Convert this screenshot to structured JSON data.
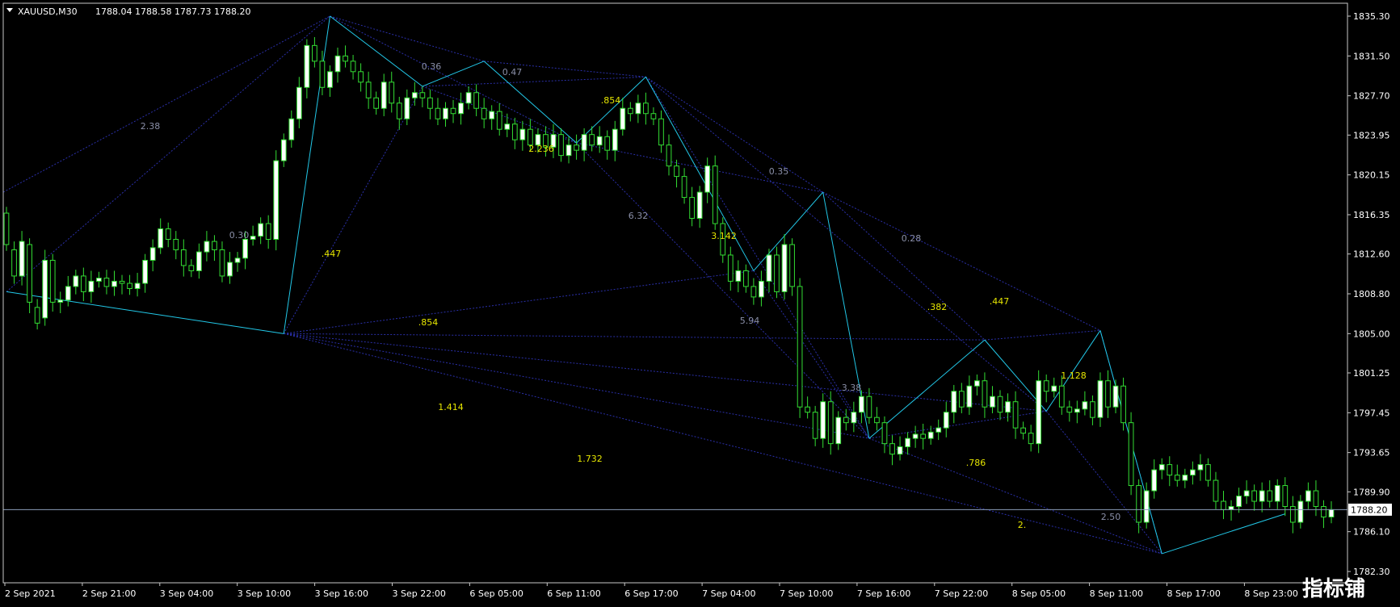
{
  "chart_data": {
    "type": "candlestick",
    "header": {
      "symbol": "XAUUSD,M30",
      "ohlc": "1788.04 1788.58 1787.73 1788.20"
    },
    "ylim": [
      1781.5,
      1836.5
    ],
    "y_ticks": [
      "1835.30",
      "1831.50",
      "1827.70",
      "1823.95",
      "1820.15",
      "1816.35",
      "1812.60",
      "1808.80",
      "1805.00",
      "1801.25",
      "1797.45",
      "1793.65",
      "1789.90",
      "1786.10",
      "1782.30"
    ],
    "x_ticks": [
      "2 Sep 2021",
      "2 Sep 21:00",
      "3 Sep 04:00",
      "3 Sep 10:00",
      "3 Sep 16:00",
      "3 Sep 22:00",
      "6 Sep 05:00",
      "6 Sep 11:00",
      "6 Sep 17:00",
      "7 Sep 04:00",
      "7 Sep 10:00",
      "7 Sep 16:00",
      "7 Sep 22:00",
      "8 Sep 05:00",
      "8 Sep 11:00",
      "8 Sep 17:00",
      "8 Sep 23:00"
    ],
    "current_price": "1788.20",
    "candles": [
      [
        1816.5,
        1813.5
      ],
      [
        1813.0,
        1810.5
      ],
      [
        1810.5,
        1813.8
      ],
      [
        1813.5,
        1808.0
      ],
      [
        1807.5,
        1806.0
      ],
      [
        1806.5,
        1812.0
      ],
      [
        1812.0,
        1808.0
      ],
      [
        1808.0,
        1808.2
      ],
      [
        1808.2,
        1809.5
      ],
      [
        1809.5,
        1810.5
      ],
      [
        1810.5,
        1809.0
      ],
      [
        1809.0,
        1810.0
      ],
      [
        1810.0,
        1810.3
      ],
      [
        1810.3,
        1809.5
      ],
      [
        1809.5,
        1810.0
      ],
      [
        1810.0,
        1809.8
      ],
      [
        1809.8,
        1809.3
      ],
      [
        1809.3,
        1809.8
      ],
      [
        1809.8,
        1812.0
      ],
      [
        1812.0,
        1813.2
      ],
      [
        1813.2,
        1815.0
      ],
      [
        1815.0,
        1814.0
      ],
      [
        1814.0,
        1813.0
      ],
      [
        1813.0,
        1811.5
      ],
      [
        1811.5,
        1811.0
      ],
      [
        1811.0,
        1812.8
      ],
      [
        1812.8,
        1813.8
      ],
      [
        1813.8,
        1813.0
      ],
      [
        1813.0,
        1810.5
      ],
      [
        1810.5,
        1811.8
      ],
      [
        1811.8,
        1812.2
      ],
      [
        1812.2,
        1814.0
      ],
      [
        1814.0,
        1814.3
      ],
      [
        1814.3,
        1815.5
      ],
      [
        1815.5,
        1814.0
      ],
      [
        1814.0,
        1821.5
      ],
      [
        1821.5,
        1823.5
      ],
      [
        1823.5,
        1825.5
      ],
      [
        1825.5,
        1828.5
      ],
      [
        1828.5,
        1832.5
      ],
      [
        1832.5,
        1831.0
      ],
      [
        1831.0,
        1828.5
      ],
      [
        1828.5,
        1830.0
      ],
      [
        1830.0,
        1831.5
      ],
      [
        1831.5,
        1831.0
      ],
      [
        1831.0,
        1830.0
      ],
      [
        1830.0,
        1829.0
      ],
      [
        1829.0,
        1827.5
      ],
      [
        1827.5,
        1826.5
      ],
      [
        1826.5,
        1829.0
      ],
      [
        1829.0,
        1827.0
      ],
      [
        1827.0,
        1825.5
      ],
      [
        1825.5,
        1827.5
      ],
      [
        1827.5,
        1828.0
      ],
      [
        1828.0,
        1827.5
      ],
      [
        1827.5,
        1826.5
      ],
      [
        1826.5,
        1825.5
      ],
      [
        1825.5,
        1826.5
      ],
      [
        1826.5,
        1826.0
      ],
      [
        1826.0,
        1827.0
      ],
      [
        1827.0,
        1828.0
      ],
      [
        1828.0,
        1826.5
      ],
      [
        1826.5,
        1825.5
      ],
      [
        1825.5,
        1826.2
      ],
      [
        1826.2,
        1824.5
      ],
      [
        1824.5,
        1825.0
      ],
      [
        1825.0,
        1823.5
      ],
      [
        1823.5,
        1824.5
      ],
      [
        1824.5,
        1823.0
      ],
      [
        1823.0,
        1824.0
      ],
      [
        1824.0,
        1822.8
      ],
      [
        1822.8,
        1824.0
      ],
      [
        1824.0,
        1822.0
      ],
      [
        1822.0,
        1823.0
      ],
      [
        1823.0,
        1822.5
      ],
      [
        1822.5,
        1824.0
      ],
      [
        1824.0,
        1823.0
      ],
      [
        1823.0,
        1823.8
      ],
      [
        1823.8,
        1822.5
      ],
      [
        1822.5,
        1824.5
      ],
      [
        1824.5,
        1826.5
      ],
      [
        1826.5,
        1826.0
      ],
      [
        1826.0,
        1827.0
      ],
      [
        1827.0,
        1826.0
      ],
      [
        1826.0,
        1825.5
      ],
      [
        1825.5,
        1823.0
      ],
      [
        1823.0,
        1821.0
      ],
      [
        1821.0,
        1820.0
      ],
      [
        1820.0,
        1818.0
      ],
      [
        1818.0,
        1816.0
      ],
      [
        1816.0,
        1818.5
      ],
      [
        1818.5,
        1821.0
      ],
      [
        1821.0,
        1815.5
      ],
      [
        1815.5,
        1812.5
      ],
      [
        1812.5,
        1810.0
      ],
      [
        1810.0,
        1811.0
      ],
      [
        1811.0,
        1809.5
      ],
      [
        1809.5,
        1808.5
      ],
      [
        1808.5,
        1810.0
      ],
      [
        1810.0,
        1812.5
      ],
      [
        1812.5,
        1809.0
      ],
      [
        1809.0,
        1813.5
      ],
      [
        1813.5,
        1809.5
      ],
      [
        1809.5,
        1798.0
      ],
      [
        1798.0,
        1797.5
      ],
      [
        1797.5,
        1795.0
      ],
      [
        1795.0,
        1798.5
      ],
      [
        1798.5,
        1794.5
      ],
      [
        1794.5,
        1797.0
      ],
      [
        1797.0,
        1796.5
      ],
      [
        1796.5,
        1797.5
      ],
      [
        1797.5,
        1799.0
      ],
      [
        1799.0,
        1797.0
      ],
      [
        1797.0,
        1796.5
      ],
      [
        1796.5,
        1794.5
      ],
      [
        1794.5,
        1793.5
      ],
      [
        1793.5,
        1794.2
      ],
      [
        1794.2,
        1795.0
      ],
      [
        1795.0,
        1795.4
      ],
      [
        1795.4,
        1795.0
      ],
      [
        1795.0,
        1795.6
      ],
      [
        1795.6,
        1796.0
      ],
      [
        1796.0,
        1797.5
      ],
      [
        1797.5,
        1799.5
      ],
      [
        1799.5,
        1798.0
      ],
      [
        1798.0,
        1800.0
      ],
      [
        1800.0,
        1800.5
      ],
      [
        1800.5,
        1798.0
      ],
      [
        1798.0,
        1799.0
      ],
      [
        1799.0,
        1797.5
      ],
      [
        1797.5,
        1798.5
      ],
      [
        1798.5,
        1796.0
      ],
      [
        1796.0,
        1795.5
      ],
      [
        1795.5,
        1794.5
      ],
      [
        1794.5,
        1800.5
      ],
      [
        1800.5,
        1799.5
      ],
      [
        1799.5,
        1800.0
      ],
      [
        1800.0,
        1798.0
      ],
      [
        1798.0,
        1797.5
      ],
      [
        1797.5,
        1797.8
      ],
      [
        1797.8,
        1798.5
      ],
      [
        1798.5,
        1797.0
      ],
      [
        1797.0,
        1800.5
      ],
      [
        1800.5,
        1798.0
      ],
      [
        1798.0,
        1800.0
      ],
      [
        1800.0,
        1796.5
      ],
      [
        1796.5,
        1790.5
      ],
      [
        1790.5,
        1787.0
      ],
      [
        1787.0,
        1790.0
      ],
      [
        1790.0,
        1792.0
      ],
      [
        1792.0,
        1792.5
      ],
      [
        1792.5,
        1791.5
      ],
      [
        1791.5,
        1791.0
      ],
      [
        1791.0,
        1791.5
      ],
      [
        1791.5,
        1792.0
      ],
      [
        1792.0,
        1792.5
      ],
      [
        1792.5,
        1791.0
      ],
      [
        1791.0,
        1789.0
      ],
      [
        1789.0,
        1788.2
      ],
      [
        1788.2,
        1788.5
      ],
      [
        1788.5,
        1789.5
      ],
      [
        1789.5,
        1790.0
      ],
      [
        1790.0,
        1789.0
      ],
      [
        1789.0,
        1790.0
      ],
      [
        1790.0,
        1789.0
      ],
      [
        1789.0,
        1790.5
      ],
      [
        1790.5,
        1788.5
      ],
      [
        1788.5,
        1787.0
      ],
      [
        1787.0,
        1789.0
      ],
      [
        1789.0,
        1790.0
      ],
      [
        1790.0,
        1788.5
      ],
      [
        1788.5,
        1787.5
      ],
      [
        1787.5,
        1788.2
      ]
    ],
    "fib_labels": [
      {
        "text": "2.38",
        "color": "#8a8fa8"
      },
      {
        "text": "0.36",
        "color": "#8a8fa8"
      },
      {
        "text": "0.47",
        "color": "#8a8fa8"
      },
      {
        "text": ".854",
        "color": "#e6e600"
      },
      {
        "text": "2.236",
        "color": "#e6e600"
      },
      {
        "text": "0.35",
        "color": "#8a8fa8"
      },
      {
        "text": "0.30",
        "color": "#8a8fa8"
      },
      {
        "text": ".447",
        "color": "#e6e600"
      },
      {
        "text": "6.32",
        "color": "#8a8fa8"
      },
      {
        "text": "3.142",
        "color": "#e6e600"
      },
      {
        "text": "0.28",
        "color": "#8a8fa8"
      },
      {
        "text": ".854",
        "color": "#e6e600"
      },
      {
        "text": "5.94",
        "color": "#8a8fa8"
      },
      {
        "text": ".382",
        "color": "#e6e600"
      },
      {
        "text": ".447",
        "color": "#e6e600"
      },
      {
        "text": "1.128",
        "color": "#e6e600"
      },
      {
        "text": "3.38",
        "color": "#8a8fa8"
      },
      {
        "text": "1.414",
        "color": "#e6e600"
      },
      {
        "text": ".786",
        "color": "#e6e600"
      },
      {
        "text": "1.732",
        "color": "#e6e600"
      },
      {
        "text": "2.50",
        "color": "#8a8fa8"
      },
      {
        "text": "2.",
        "color": "#e6e600"
      }
    ],
    "colors": {
      "background": "#000000",
      "bull": "#ffffff",
      "bear": "#000000",
      "wick": "#33dd33",
      "zigzag": "#22c8e8",
      "dotted": "#2a2fa8",
      "price_line": "#8a9bb8",
      "axis": "#c8c8c8"
    }
  },
  "watermark": "指标铺"
}
